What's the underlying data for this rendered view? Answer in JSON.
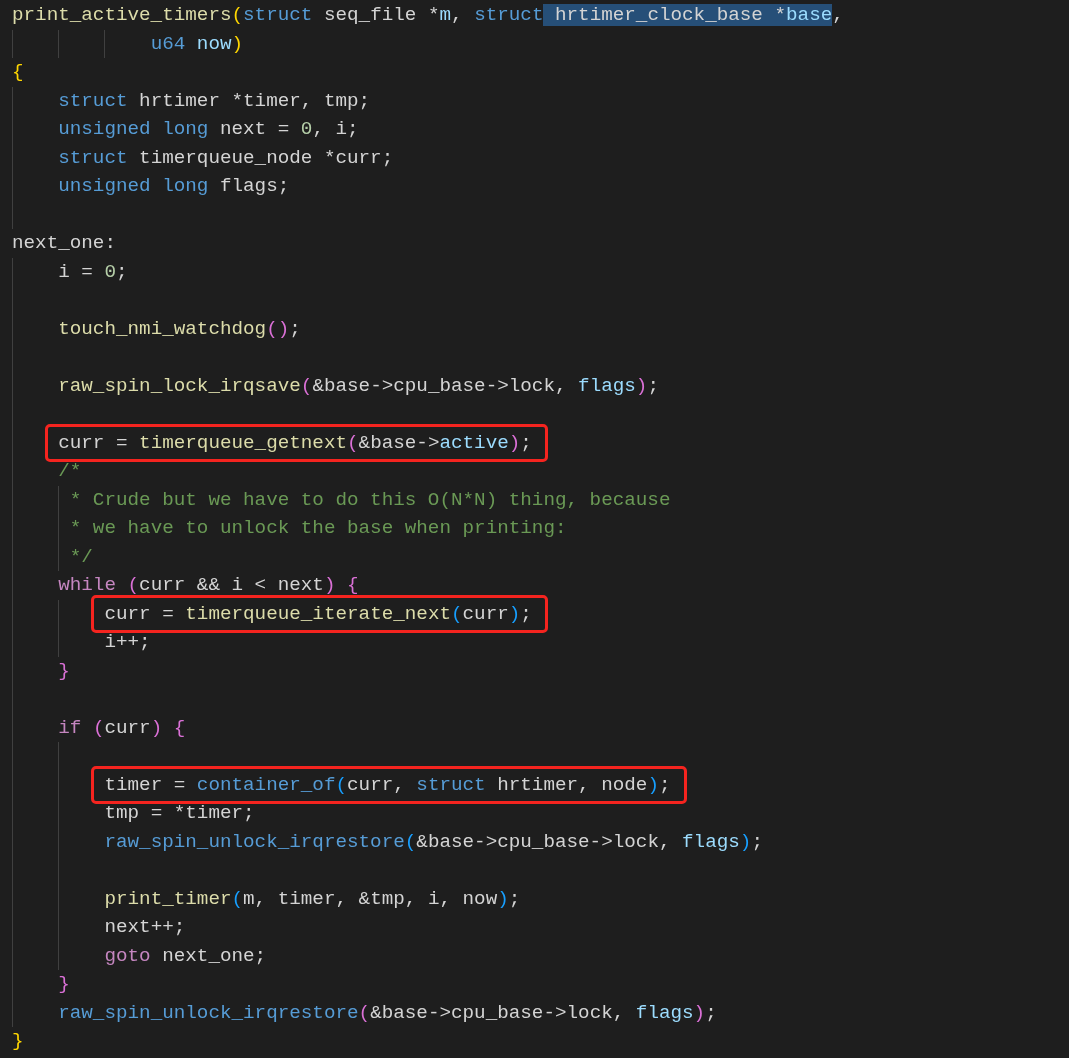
{
  "lines": [
    {
      "kind": "code",
      "boxed": false,
      "tokens": [
        {
          "text": "print_active_timers",
          "kind": "f",
          "selected": false
        },
        {
          "text": "(",
          "kind": "b1",
          "selected": false
        },
        {
          "text": "struct",
          "kind": "k",
          "selected": false
        },
        {
          "text": " seq_file *",
          "kind": "p",
          "selected": false
        },
        {
          "text": "m",
          "kind": "v",
          "selected": false
        },
        {
          "text": ", ",
          "kind": "p",
          "selected": false
        },
        {
          "text": "struct",
          "kind": "k",
          "selected": false
        },
        {
          "text": " hrtimer_clock_base *",
          "kind": "p",
          "selected": true
        },
        {
          "text": "base",
          "kind": "v",
          "selected": true
        },
        {
          "text": ",",
          "kind": "p",
          "selected": false
        }
      ]
    },
    {
      "kind": "code",
      "boxed": false,
      "tokens": [
        {
          "text": "            u64",
          "kind": "k"
        },
        {
          "text": " now",
          "kind": "v"
        },
        {
          "text": ")",
          "kind": "b1"
        }
      ]
    },
    {
      "kind": "code",
      "boxed": false,
      "tokens": [
        {
          "text": "{",
          "kind": "b1"
        }
      ]
    },
    {
      "kind": "code",
      "boxed": false,
      "tokens": [
        {
          "text": "    struct",
          "kind": "k"
        },
        {
          "text": " hrtimer *timer, tmp;",
          "kind": "p"
        }
      ]
    },
    {
      "kind": "code",
      "boxed": false,
      "tokens": [
        {
          "text": "    unsigned long",
          "kind": "k"
        },
        {
          "text": " next = ",
          "kind": "p"
        },
        {
          "text": "0",
          "kind": "n"
        },
        {
          "text": ", i;",
          "kind": "p"
        }
      ]
    },
    {
      "kind": "code",
      "boxed": false,
      "tokens": [
        {
          "text": "    struct",
          "kind": "k"
        },
        {
          "text": " timerqueue_node *curr;",
          "kind": "p"
        }
      ]
    },
    {
      "kind": "code",
      "boxed": false,
      "tokens": [
        {
          "text": "    unsigned long",
          "kind": "k"
        },
        {
          "text": " flags;",
          "kind": "p"
        }
      ]
    },
    {
      "kind": "blank"
    },
    {
      "kind": "code",
      "boxed": false,
      "tokens": [
        {
          "text": "next_one:",
          "kind": "p"
        }
      ]
    },
    {
      "kind": "code",
      "boxed": false,
      "tokens": [
        {
          "text": "    i = ",
          "kind": "p"
        },
        {
          "text": "0",
          "kind": "n"
        },
        {
          "text": ";",
          "kind": "p"
        }
      ]
    },
    {
      "kind": "blank"
    },
    {
      "kind": "code",
      "boxed": false,
      "tokens": [
        {
          "text": "    touch_nmi_watchdog",
          "kind": "f"
        },
        {
          "text": "()",
          "kind": "b2"
        },
        {
          "text": ";",
          "kind": "p"
        }
      ]
    },
    {
      "kind": "blank"
    },
    {
      "kind": "code",
      "boxed": false,
      "tokens": [
        {
          "text": "    raw_spin_lock_irqsave",
          "kind": "f"
        },
        {
          "text": "(",
          "kind": "b2"
        },
        {
          "text": "&base->cpu_base->lock, ",
          "kind": "p"
        },
        {
          "text": "flags",
          "kind": "v"
        },
        {
          "text": ")",
          "kind": "b2"
        },
        {
          "text": ";",
          "kind": "p"
        }
      ]
    },
    {
      "kind": "blank"
    },
    {
      "kind": "code",
      "boxed": true,
      "tokens": [
        {
          "text": "    curr = ",
          "kind": "p"
        },
        {
          "text": "timerqueue_getnext",
          "kind": "f"
        },
        {
          "text": "(",
          "kind": "b2"
        },
        {
          "text": "&base->",
          "kind": "p"
        },
        {
          "text": "active",
          "kind": "v"
        },
        {
          "text": ")",
          "kind": "b2"
        },
        {
          "text": ";",
          "kind": "p"
        }
      ]
    },
    {
      "kind": "code",
      "boxed": false,
      "tokens": [
        {
          "text": "    /*",
          "kind": "c"
        }
      ]
    },
    {
      "kind": "code",
      "boxed": false,
      "tokens": [
        {
          "text": "     * Crude but we have to do this O(N*N) thing, because",
          "kind": "c"
        }
      ]
    },
    {
      "kind": "code",
      "boxed": false,
      "tokens": [
        {
          "text": "     * we have to unlock the base when printing:",
          "kind": "c"
        }
      ]
    },
    {
      "kind": "code",
      "boxed": false,
      "tokens": [
        {
          "text": "     */",
          "kind": "c"
        }
      ]
    },
    {
      "kind": "code",
      "boxed": false,
      "tokens": [
        {
          "text": "    while",
          "kind": "ctl"
        },
        {
          "text": " (",
          "kind": "b2"
        },
        {
          "text": "curr && i < next",
          "kind": "p"
        },
        {
          "text": ") {",
          "kind": "b2"
        }
      ]
    },
    {
      "kind": "code",
      "boxed": true,
      "tokens": [
        {
          "text": "        curr = ",
          "kind": "p"
        },
        {
          "text": "timerqueue_iterate_next",
          "kind": "f"
        },
        {
          "text": "(",
          "kind": "b3"
        },
        {
          "text": "curr",
          "kind": "p"
        },
        {
          "text": ")",
          "kind": "b3"
        },
        {
          "text": ";",
          "kind": "p"
        }
      ]
    },
    {
      "kind": "code",
      "boxed": false,
      "tokens": [
        {
          "text": "        i++;",
          "kind": "p"
        }
      ]
    },
    {
      "kind": "code",
      "boxed": false,
      "tokens": [
        {
          "text": "    }",
          "kind": "b2"
        }
      ]
    },
    {
      "kind": "blank"
    },
    {
      "kind": "code",
      "boxed": false,
      "tokens": [
        {
          "text": "    if",
          "kind": "ctl"
        },
        {
          "text": " (",
          "kind": "b2"
        },
        {
          "text": "curr",
          "kind": "p"
        },
        {
          "text": ") {",
          "kind": "b2"
        }
      ]
    },
    {
      "kind": "blank"
    },
    {
      "kind": "code",
      "boxed": true,
      "tokens": [
        {
          "text": "        timer = ",
          "kind": "p"
        },
        {
          "text": "container_of",
          "kind": "k"
        },
        {
          "text": "(",
          "kind": "b3"
        },
        {
          "text": "curr, ",
          "kind": "p"
        },
        {
          "text": "struct",
          "kind": "k"
        },
        {
          "text": " hrtimer, node",
          "kind": "p"
        },
        {
          "text": ")",
          "kind": "b3"
        },
        {
          "text": ";",
          "kind": "p"
        }
      ]
    },
    {
      "kind": "code",
      "boxed": false,
      "tokens": [
        {
          "text": "        tmp = *timer;",
          "kind": "p"
        }
      ]
    },
    {
      "kind": "code",
      "boxed": false,
      "tokens": [
        {
          "text": "        raw_spin_unlock_irqrestore",
          "kind": "k"
        },
        {
          "text": "(",
          "kind": "b3"
        },
        {
          "text": "&base->cpu_base->lock, ",
          "kind": "p"
        },
        {
          "text": "flags",
          "kind": "v"
        },
        {
          "text": ")",
          "kind": "b3"
        },
        {
          "text": ";",
          "kind": "p"
        }
      ]
    },
    {
      "kind": "blank"
    },
    {
      "kind": "code",
      "boxed": false,
      "tokens": [
        {
          "text": "        print_timer",
          "kind": "f"
        },
        {
          "text": "(",
          "kind": "b3"
        },
        {
          "text": "m, timer, &tmp, i, now",
          "kind": "p"
        },
        {
          "text": ")",
          "kind": "b3"
        },
        {
          "text": ";",
          "kind": "p"
        }
      ]
    },
    {
      "kind": "code",
      "boxed": false,
      "tokens": [
        {
          "text": "        next++;",
          "kind": "p"
        }
      ]
    },
    {
      "kind": "code",
      "boxed": false,
      "tokens": [
        {
          "text": "        goto",
          "kind": "ctl"
        },
        {
          "text": " next_one;",
          "kind": "p"
        }
      ]
    },
    {
      "kind": "code",
      "boxed": false,
      "tokens": [
        {
          "text": "    }",
          "kind": "b2"
        }
      ]
    },
    {
      "kind": "code",
      "boxed": false,
      "tokens": [
        {
          "text": "    raw_spin_unlock_irqrestore",
          "kind": "k"
        },
        {
          "text": "(",
          "kind": "b2"
        },
        {
          "text": "&base->cpu_base->lock, ",
          "kind": "p"
        },
        {
          "text": "flags",
          "kind": "v"
        },
        {
          "text": ")",
          "kind": "b2"
        },
        {
          "text": ";",
          "kind": "p"
        }
      ]
    },
    {
      "kind": "code",
      "boxed": false,
      "tokens": [
        {
          "text": "}",
          "kind": "b1"
        }
      ]
    }
  ]
}
